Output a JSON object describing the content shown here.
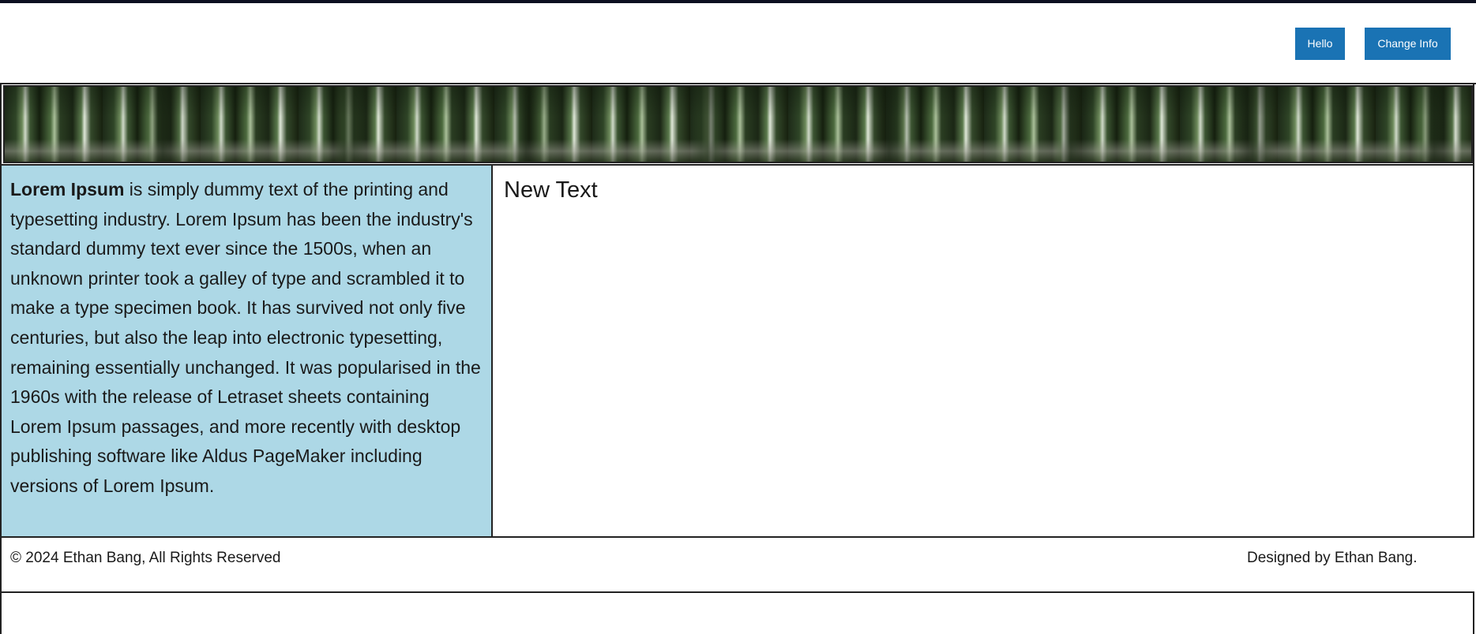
{
  "header": {
    "hello_label": "Hello",
    "change_info_label": "Change Info"
  },
  "sidebar": {
    "lead": "Lorem Ipsum",
    "text": " is simply dummy text of the printing and typesetting industry. Lorem Ipsum has been the industry's standard dummy text ever since the 1500s, when an unknown printer took a galley of type and scrambled it to make a type specimen book. It has survived not only five centuries, but also the leap into electronic typesetting, remaining essentially unchanged. It was popularised in the 1960s with the release of Letraset sheets containing Lorem Ipsum passages, and more recently with desktop publishing software like Aldus PageMaker including versions of Lorem Ipsum."
  },
  "content": {
    "heading": "New Text"
  },
  "footer": {
    "copyright": "© 2024 Ethan Bang, All Rights Reserved",
    "credit": "Designed by Ethan Bang."
  },
  "colors": {
    "button": "#1a73b4",
    "sidebar_bg": "#add8e6",
    "border": "#222222"
  },
  "banner": {
    "image": "forest-image"
  }
}
